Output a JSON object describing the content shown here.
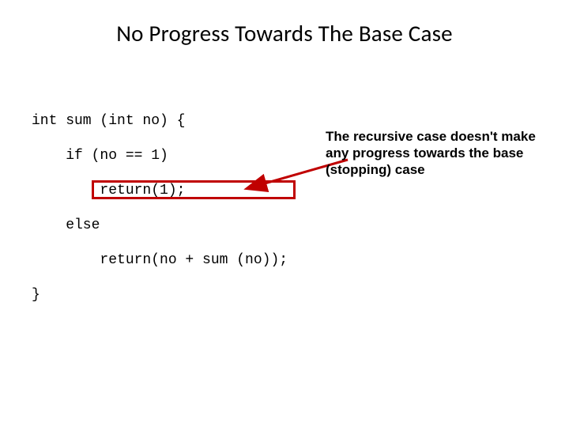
{
  "title": "No Progress Towards The Base Case",
  "code": {
    "l1": "int sum (int no) {",
    "l2": "    if (no == 1)",
    "l3": "        return(1);",
    "l4": "    else",
    "l5": "        return(no + sum (no));",
    "l6": "}"
  },
  "annotation": "The recursive case doesn't make any progress towards the base (stopping) case",
  "colors": {
    "highlight_border": "#c00000",
    "arrow": "#c00000"
  }
}
